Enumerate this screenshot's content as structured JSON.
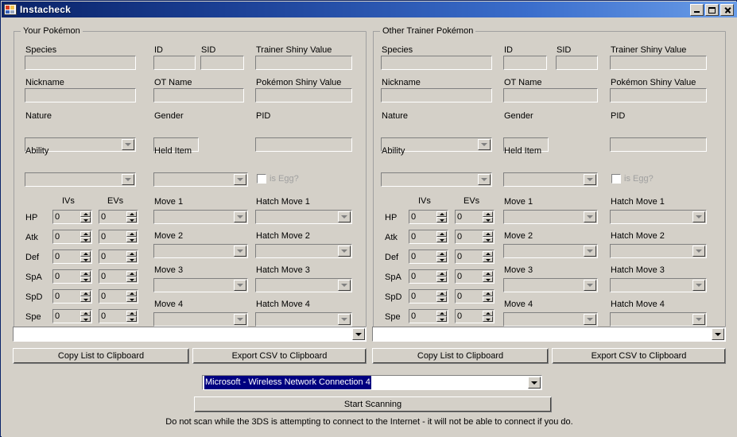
{
  "window": {
    "title": "Instacheck",
    "icon": "form-icon",
    "minimize": "minimize-button",
    "maximize": "maximize-button",
    "close": "close-button"
  },
  "panels": [
    {
      "id": "your-pokemon",
      "title": "Your Pokémon",
      "fields": {
        "species_label": "Species",
        "species_value": "",
        "id_label": "ID",
        "id_value": "",
        "sid_label": "SID",
        "sid_value": "",
        "tsv_label": "Trainer Shiny Value",
        "tsv_value": "",
        "nickname_label": "Nickname",
        "nickname_value": "",
        "ot_label": "OT Name",
        "ot_value": "",
        "psv_label": "Pokémon Shiny Value",
        "psv_value": "",
        "nature_label": "Nature",
        "nature_value": "",
        "gender_label": "Gender",
        "gender_value": "",
        "pid_label": "PID",
        "pid_value": "",
        "ability_label": "Ability",
        "ability_value": "",
        "held_item_label": "Held Item",
        "held_item_value": "",
        "is_egg_label": "is Egg?",
        "is_egg_checked": false
      },
      "stats": {
        "iv_header": "IVs",
        "ev_header": "EVs",
        "rows": [
          {
            "name": "HP",
            "iv": "0",
            "ev": "0"
          },
          {
            "name": "Atk",
            "iv": "0",
            "ev": "0"
          },
          {
            "name": "Def",
            "iv": "0",
            "ev": "0"
          },
          {
            "name": "SpA",
            "iv": "0",
            "ev": "0"
          },
          {
            "name": "SpD",
            "iv": "0",
            "ev": "0"
          },
          {
            "name": "Spe",
            "iv": "0",
            "ev": "0"
          }
        ]
      },
      "moves": [
        {
          "label": "Move 1",
          "value": ""
        },
        {
          "label": "Move 2",
          "value": ""
        },
        {
          "label": "Move 3",
          "value": ""
        },
        {
          "label": "Move 4",
          "value": ""
        }
      ],
      "hatch_moves": [
        {
          "label": "Hatch Move 1",
          "value": ""
        },
        {
          "label": "Hatch Move 2",
          "value": ""
        },
        {
          "label": "Hatch Move 3",
          "value": ""
        },
        {
          "label": "Hatch Move 4",
          "value": ""
        }
      ],
      "results_combo_value": "",
      "copy_button": "Copy List to Clipboard",
      "export_button": "Export CSV to Clipboard"
    },
    {
      "id": "other-trainer-pokemon",
      "title": "Other Trainer Pokémon",
      "fields": {
        "species_label": "Species",
        "species_value": "",
        "id_label": "ID",
        "id_value": "",
        "sid_label": "SID",
        "sid_value": "",
        "tsv_label": "Trainer Shiny Value",
        "tsv_value": "",
        "nickname_label": "Nickname",
        "nickname_value": "",
        "ot_label": "OT Name",
        "ot_value": "",
        "psv_label": "Pokémon Shiny Value",
        "psv_value": "",
        "nature_label": "Nature",
        "nature_value": "",
        "gender_label": "Gender",
        "gender_value": "",
        "pid_label": "PID",
        "pid_value": "",
        "ability_label": "Ability",
        "ability_value": "",
        "held_item_label": "Held Item",
        "held_item_value": "",
        "is_egg_label": "is Egg?",
        "is_egg_checked": false
      },
      "stats": {
        "iv_header": "IVs",
        "ev_header": "EVs",
        "rows": [
          {
            "name": "HP",
            "iv": "0",
            "ev": "0"
          },
          {
            "name": "Atk",
            "iv": "0",
            "ev": "0"
          },
          {
            "name": "Def",
            "iv": "0",
            "ev": "0"
          },
          {
            "name": "SpA",
            "iv": "0",
            "ev": "0"
          },
          {
            "name": "SpD",
            "iv": "0",
            "ev": "0"
          },
          {
            "name": "Spe",
            "iv": "0",
            "ev": "0"
          }
        ]
      },
      "moves": [
        {
          "label": "Move 1",
          "value": ""
        },
        {
          "label": "Move 2",
          "value": ""
        },
        {
          "label": "Move 3",
          "value": ""
        },
        {
          "label": "Move 4",
          "value": ""
        }
      ],
      "hatch_moves": [
        {
          "label": "Hatch Move 1",
          "value": ""
        },
        {
          "label": "Hatch Move 2",
          "value": ""
        },
        {
          "label": "Hatch Move 3",
          "value": ""
        },
        {
          "label": "Hatch Move 4",
          "value": ""
        }
      ],
      "results_combo_value": "",
      "copy_button": "Copy List to Clipboard",
      "export_button": "Export CSV to Clipboard"
    }
  ],
  "footer": {
    "adapter_value": "Microsoft - Wireless Network Connection 4",
    "adapter_selected": true,
    "scan_button": "Start Scanning",
    "warning": "Do not scan while the 3DS is attempting to connect to the Internet - it will not be able to connect if you do."
  },
  "colors": {
    "window_face": "#d4d0c8",
    "title_gradient_start": "#0a246a",
    "title_gradient_end": "#6a9de8",
    "selection_bg": "#000080",
    "selection_fg": "#ffffff",
    "disabled_text": "#a0a0a0"
  }
}
